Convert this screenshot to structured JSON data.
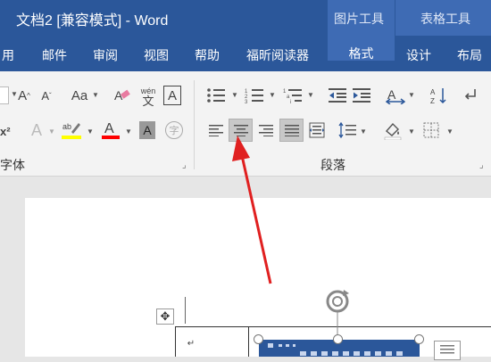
{
  "window": {
    "title": "文档2 [兼容模式] - Word"
  },
  "context_tabs": {
    "picture_tools": "图片工具",
    "table_tools": "表格工具"
  },
  "tabs": [
    {
      "label": "用"
    },
    {
      "label": "邮件"
    },
    {
      "label": "审阅"
    },
    {
      "label": "视图"
    },
    {
      "label": "帮助"
    },
    {
      "label": "福昕阅读器"
    },
    {
      "label": "格式"
    },
    {
      "label": "设计"
    },
    {
      "label": "布局"
    }
  ],
  "ribbon": {
    "font_group_label": "字体",
    "paragraph_group_label": "段落",
    "phonetic_top": "wén",
    "phonetic_bottom": "文",
    "launcher_glyph": "⌟",
    "colors": {
      "highlight": "#ffff00",
      "font_color": "#ff0000",
      "selected": "#c8c8c8"
    }
  },
  "document": {
    "paragraph_mark": "↵",
    "move_handle": "✥"
  },
  "annotation": {
    "arrow_color": "#e02020"
  }
}
